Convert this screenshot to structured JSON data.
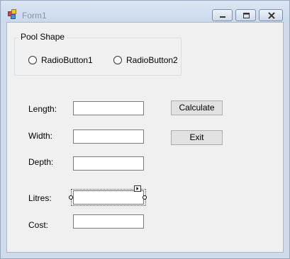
{
  "window": {
    "title": "Form1",
    "controls": {
      "minimize_icon": "minimize-icon",
      "maximize_icon": "maximize-icon",
      "close_icon": "close-icon"
    }
  },
  "group": {
    "title": "Pool Shape",
    "radios": [
      {
        "label": "RadioButton1",
        "selected": false
      },
      {
        "label": "RadioButton2",
        "selected": false
      }
    ]
  },
  "fields": {
    "length": {
      "label": "Length:",
      "value": ""
    },
    "width": {
      "label": "Width:",
      "value": ""
    },
    "depth": {
      "label": "Depth:",
      "value": ""
    },
    "litres": {
      "label": "Litres:",
      "value": ""
    },
    "cost": {
      "label": "Cost:",
      "value": ""
    }
  },
  "buttons": {
    "calculate": "Calculate",
    "exit": "Exit"
  },
  "colors": {
    "title_bar": "#cfdbeb",
    "client_bg": "#f0f0f0",
    "button_bg": "#e1e1e1"
  }
}
